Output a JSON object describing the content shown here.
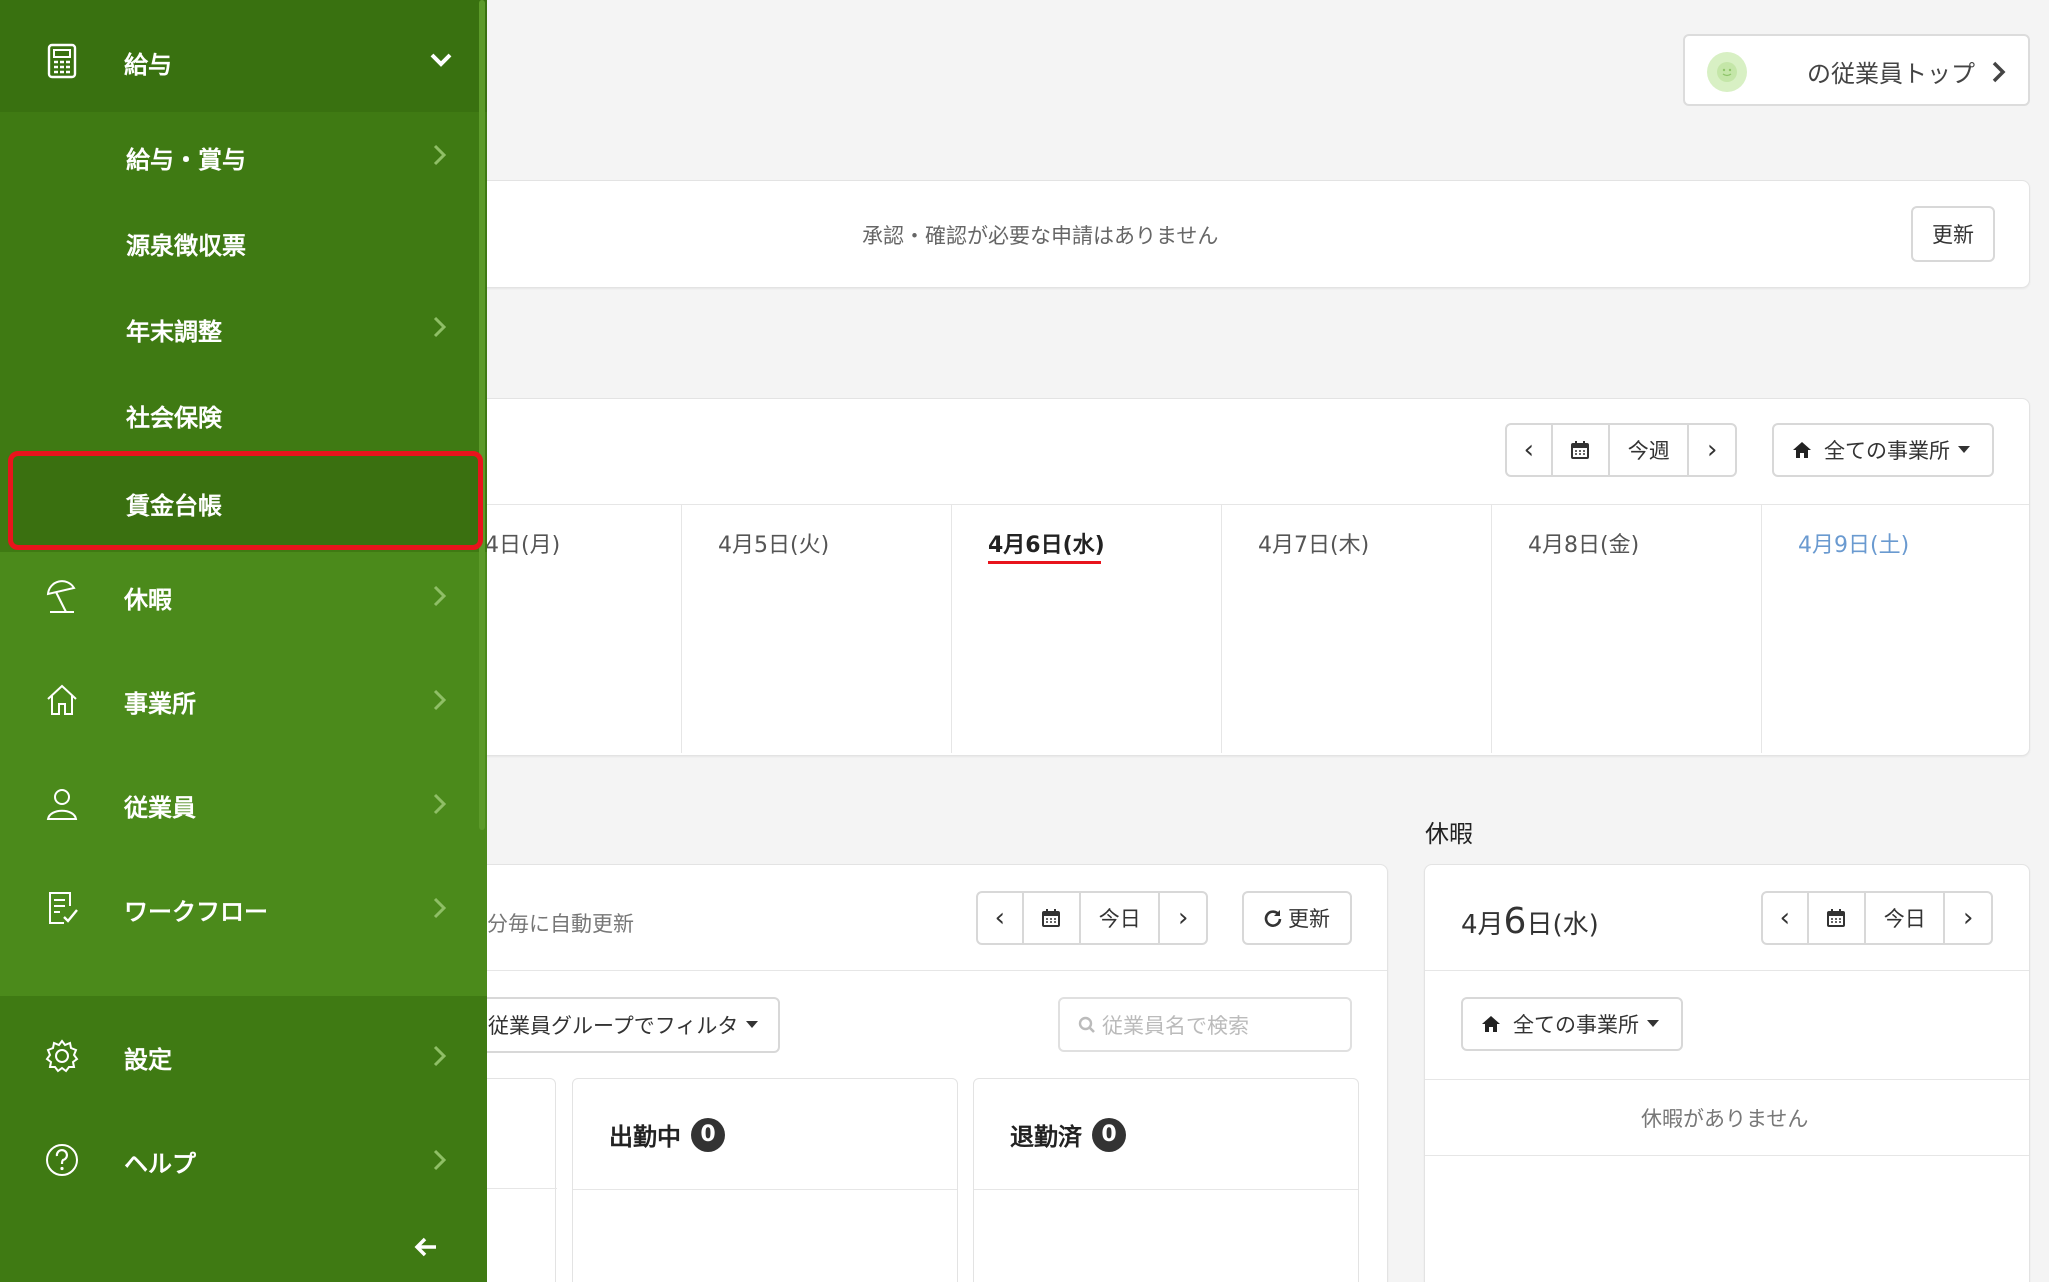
{
  "colors": {
    "sidebar": "#4b8a1b",
    "sidebar_dark": "#3f7a13",
    "highlight_border": "#e8141c",
    "today_underline": "#e8141c",
    "saturday": "#6a9ad0"
  },
  "header": {
    "employee_top_label": "の従業員トップ"
  },
  "approvals": {
    "message": "承認・確認が必要な申請はありません",
    "refresh_label": "更新"
  },
  "weekly": {
    "nav": {
      "prev": "‹",
      "today_label": "今週",
      "next": "›"
    },
    "office_filter": "全ての事業所",
    "days": [
      {
        "label": "4日(月)"
      },
      {
        "label": "4月5日(火)"
      },
      {
        "label": "4月6日(水)"
      },
      {
        "label": "4月7日(木)"
      },
      {
        "label": "4月8日(金)"
      },
      {
        "label": "4月9日(土)"
      }
    ]
  },
  "attendance": {
    "auto_refresh_note": "分毎に自動更新",
    "nav": {
      "prev": "‹",
      "today_label": "今日",
      "next": "›"
    },
    "refresh_label": "更新",
    "group_filter": "従業員グループでフィルタ",
    "search_placeholder": "従業員名で検索",
    "columns": [
      {
        "label": "出勤中",
        "count": "0"
      },
      {
        "label": "退勤済",
        "count": "0"
      }
    ]
  },
  "leave": {
    "section_title": "休暇",
    "date_month": "4月",
    "date_day": "6",
    "date_suffix": "日(水)",
    "nav": {
      "prev": "‹",
      "today_label": "今日",
      "next": "›"
    },
    "office_filter": "全ての事業所",
    "empty_message": "休暇がありません"
  },
  "sidebar": {
    "payroll": {
      "label": "給与",
      "icon": "calculator-icon"
    },
    "sub_items": [
      {
        "label": "給与・賞与",
        "has_chevron": true
      },
      {
        "label": "源泉徴収票",
        "has_chevron": false
      },
      {
        "label": "年末調整",
        "has_chevron": true
      },
      {
        "label": "社会保険",
        "has_chevron": false
      },
      {
        "label": "賃金台帳",
        "has_chevron": false,
        "highlighted": true
      }
    ],
    "items": [
      {
        "label": "休暇",
        "icon": "beach-umbrella-icon"
      },
      {
        "label": "事業所",
        "icon": "home-icon"
      },
      {
        "label": "従業員",
        "icon": "person-icon"
      },
      {
        "label": "ワークフロー",
        "icon": "workflow-icon"
      }
    ],
    "bottom_items": [
      {
        "label": "設定",
        "icon": "gear-icon"
      },
      {
        "label": "ヘルプ",
        "icon": "help-icon"
      }
    ],
    "collapse_icon": "arrow-left-icon"
  }
}
